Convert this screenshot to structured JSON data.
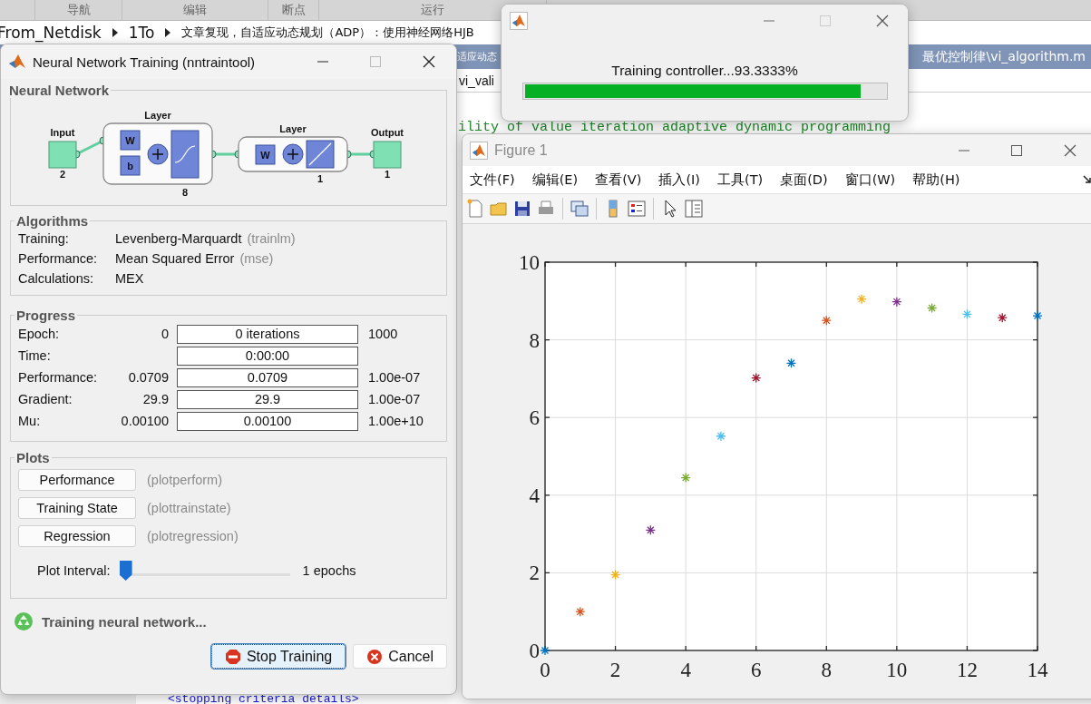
{
  "editor": {
    "toolstrip_sections": [
      "导航",
      "编辑",
      "断点",
      "运行"
    ],
    "breadcrumb": [
      "From_Netdisk",
      "1To",
      "文章复现，自适应动态规划（ADP）：使用神经网络HJB"
    ],
    "path_left": "适应动态",
    "path_right": "最优控制律\\vi_algorithm.m",
    "tab": "vi_vali",
    "code_top": "ility of value iteration adaptive dynamic programming",
    "code_bottom": "<stopping criteria details>"
  },
  "nntraintool": {
    "title": "Neural Network Training (nntraintool)",
    "network": {
      "title": "Neural Network",
      "input": {
        "label": "Input",
        "size": "2"
      },
      "layers": [
        {
          "label": "Layer",
          "size": "8",
          "weight": "W",
          "bias": "b",
          "kind": "sigmoid"
        },
        {
          "label": "Layer",
          "size": "1",
          "weight": "W",
          "kind": "linear"
        }
      ],
      "output": {
        "label": "Output",
        "size": "1"
      }
    },
    "algorithms": {
      "title": "Algorithms",
      "rows": [
        {
          "label": "Training:",
          "value": "Levenberg-Marquardt",
          "detail": "(trainlm)"
        },
        {
          "label": "Performance:",
          "value": "Mean Squared Error",
          "detail": "(mse)"
        },
        {
          "label": "Calculations:",
          "value": "MEX"
        }
      ]
    },
    "progress": {
      "title": "Progress",
      "rows": [
        {
          "label": "Epoch:",
          "start": "0",
          "current": "0 iterations",
          "target": "1000"
        },
        {
          "label": "Time:",
          "current": "0:00:00"
        },
        {
          "label": "Performance:",
          "start": "0.0709",
          "current": "0.0709",
          "target": "1.00e-07"
        },
        {
          "label": "Gradient:",
          "start": "29.9",
          "current": "29.9",
          "target": "1.00e-07"
        },
        {
          "label": "Mu:",
          "start": "0.00100",
          "current": "0.00100",
          "target": "1.00e+10"
        }
      ]
    },
    "plots": {
      "title": "Plots",
      "buttons": [
        {
          "label": "Performance",
          "function": "(plotperform)"
        },
        {
          "label": "Training State",
          "function": "(plottrainstate)"
        },
        {
          "label": "Regression",
          "function": "(plotregression)"
        }
      ],
      "interval": {
        "label": "Plot Interval:",
        "level": 0,
        "reading": "1 epochs"
      }
    },
    "status": "Training neural network...",
    "buttons": [
      {
        "label": "Stop Training",
        "kind": "stop",
        "focused": true
      },
      {
        "label": "Cancel",
        "kind": "cancel",
        "focused": false
      }
    ]
  },
  "progress_dialog": {
    "message": "Training controller...93.3333%",
    "level": 0.933
  },
  "figure": {
    "title": "Figure 1",
    "menu": [
      "文件(F)",
      "编辑(E)",
      "查看(V)",
      "插入(I)",
      "工具(T)",
      "桌面(D)",
      "窗口(W)",
      "帮助(H)"
    ],
    "chart_data": {
      "type": "scatter",
      "grid": true,
      "x": [
        0,
        1,
        2,
        3,
        4,
        5,
        6,
        7,
        8,
        9,
        10,
        11,
        12,
        13,
        14
      ],
      "xlim": [
        0,
        14
      ],
      "ylim": [
        0,
        10
      ],
      "xticks": [
        0,
        2,
        4,
        6,
        8,
        10,
        12,
        14
      ],
      "yticks": [
        0,
        2,
        4,
        6,
        8,
        10
      ],
      "series": [
        {
          "color": "#0072bd",
          "values": [
            0,
            null,
            null,
            null,
            null,
            null,
            null,
            7.4,
            null,
            null,
            null,
            null,
            null,
            null,
            8.62
          ]
        },
        {
          "color": "#d95319",
          "values": [
            null,
            1.0,
            null,
            null,
            null,
            null,
            null,
            null,
            8.5,
            null,
            null,
            null,
            null,
            null,
            null
          ]
        },
        {
          "color": "#edb120",
          "values": [
            null,
            null,
            1.95,
            null,
            null,
            null,
            null,
            null,
            null,
            9.05,
            null,
            null,
            null,
            null,
            null
          ]
        },
        {
          "color": "#7e2f8e",
          "values": [
            null,
            null,
            null,
            3.1,
            null,
            null,
            null,
            null,
            null,
            null,
            8.98,
            null,
            null,
            null,
            null
          ]
        },
        {
          "color": "#77ac30",
          "values": [
            null,
            null,
            null,
            null,
            4.45,
            null,
            null,
            null,
            null,
            null,
            null,
            8.82,
            null,
            null,
            null
          ]
        },
        {
          "color": "#4dbeee",
          "values": [
            null,
            null,
            null,
            null,
            null,
            5.52,
            null,
            null,
            null,
            null,
            null,
            null,
            8.66,
            null,
            null
          ]
        },
        {
          "color": "#a2142f",
          "values": [
            null,
            null,
            null,
            null,
            null,
            null,
            7.02,
            null,
            null,
            null,
            null,
            null,
            null,
            8.57,
            null
          ]
        }
      ]
    }
  }
}
